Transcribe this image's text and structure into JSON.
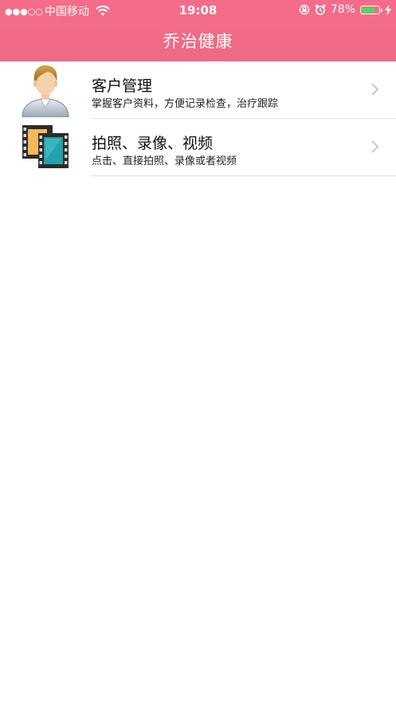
{
  "status_bar": {
    "signal_dots": "●●●○○",
    "carrier": "中国移动",
    "time": "19:08",
    "battery_percent": "78%",
    "battery_level": 0.78,
    "icons": [
      "wifi-icon",
      "rotation-lock-icon",
      "alarm-icon",
      "battery-icon",
      "charging-icon"
    ]
  },
  "nav": {
    "title": "乔治健康"
  },
  "menu": {
    "items": [
      {
        "title": "客户管理",
        "subtitle": "掌握客户资料，方便记录检查，治疗跟踪",
        "icon": "user-avatar-icon"
      },
      {
        "title": "拍照、录像、视频",
        "subtitle": "点击、直接拍照、录像或者视频",
        "icon": "film-frames-icon"
      }
    ]
  },
  "colors": {
    "header": "#ef6a83",
    "battery": "#4cd964",
    "divider": "#e0e0e0",
    "chevron": "#c7c7cc"
  }
}
